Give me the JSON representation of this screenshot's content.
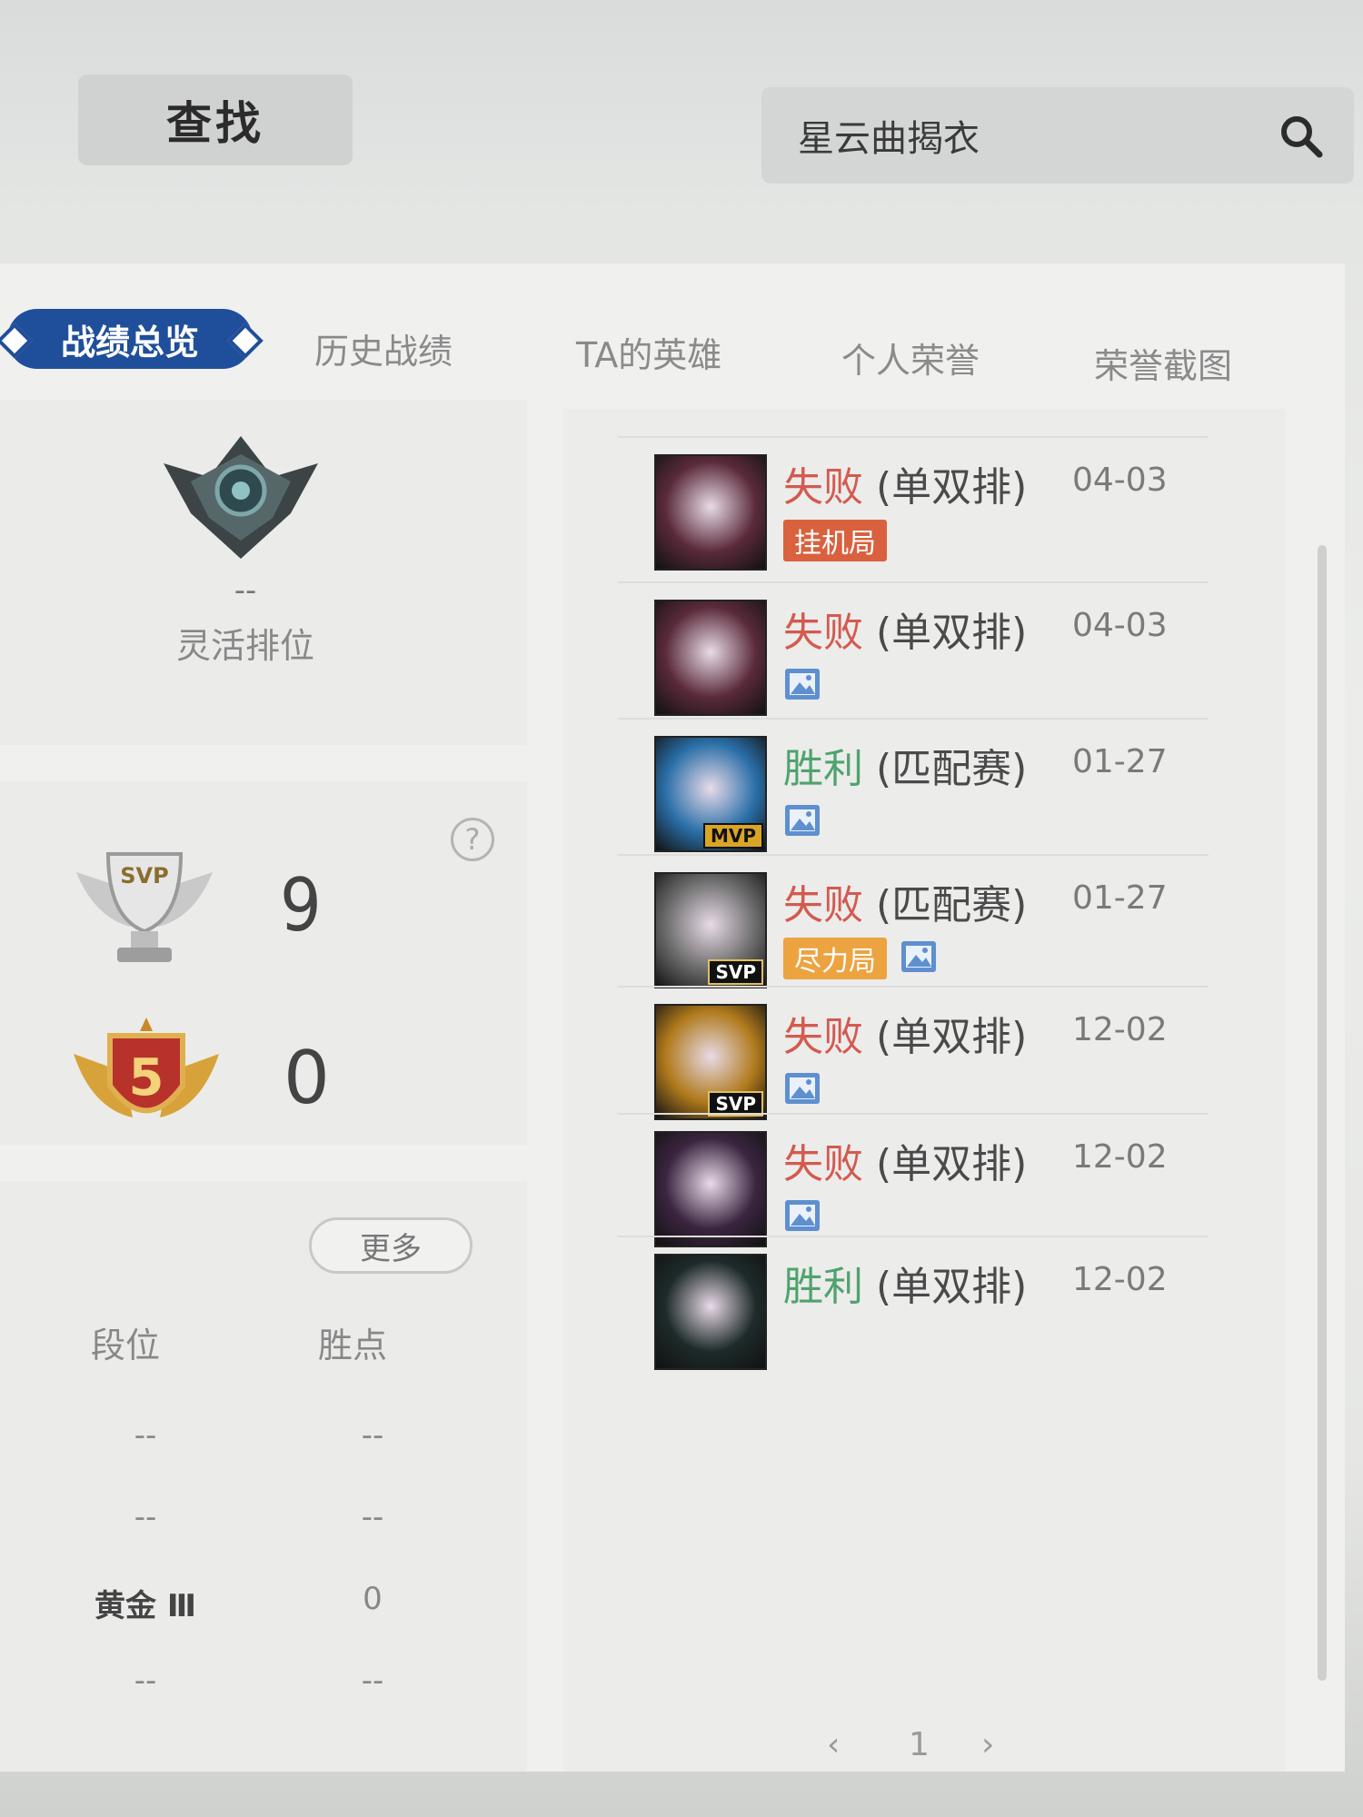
{
  "search": {
    "find_label": "查找",
    "query": "星云曲揭衣"
  },
  "tabs": [
    {
      "label": "战绩总览",
      "active": true
    },
    {
      "label": "历史战绩",
      "active": false
    },
    {
      "label": "TA的英雄",
      "active": false
    },
    {
      "label": "个人荣誉",
      "active": false
    },
    {
      "label": "荣誉截图",
      "active": false
    }
  ],
  "rank": {
    "value": "--",
    "queue": "灵活排位"
  },
  "honors": {
    "help_symbol": "?",
    "svp_label": "SVP",
    "svp_count": "9",
    "penta_label": "5",
    "penta_count": "0"
  },
  "season": {
    "more_label": "更多",
    "headers": [
      "段位",
      "胜点"
    ],
    "rows": [
      [
        "--",
        "--"
      ],
      [
        "--",
        "--"
      ],
      [
        "黄金 Ⅲ",
        "0"
      ],
      [
        "--",
        "--"
      ]
    ]
  },
  "matches": [
    {
      "result": "失败",
      "mode": "(单双排)",
      "date": "04-03",
      "outcome": "lose",
      "tag": "挂机局",
      "tag_type": "afk",
      "pic": false,
      "badge": "",
      "hero_color": "#5a2a3a"
    },
    {
      "result": "失败",
      "mode": "(单双排)",
      "date": "04-03",
      "outcome": "lose",
      "tag": "",
      "tag_type": "",
      "pic": true,
      "badge": "",
      "hero_color": "#5a2a3a"
    },
    {
      "result": "胜利",
      "mode": "(匹配赛)",
      "date": "01-27",
      "outcome": "win",
      "tag": "",
      "tag_type": "",
      "pic": true,
      "badge": "MVP",
      "hero_color": "#2a6fa8"
    },
    {
      "result": "失败",
      "mode": "(匹配赛)",
      "date": "01-27",
      "outcome": "lose",
      "tag": "尽力局",
      "tag_type": "effort",
      "pic": true,
      "badge": "SVP",
      "hero_color": "#6b6b6b"
    },
    {
      "result": "失败",
      "mode": "(单双排)",
      "date": "12-02",
      "outcome": "lose",
      "tag": "",
      "tag_type": "",
      "pic": true,
      "badge": "SVP",
      "hero_color": "#b07a1c"
    },
    {
      "result": "失败",
      "mode": "(单双排)",
      "date": "12-02",
      "outcome": "lose",
      "tag": "",
      "tag_type": "",
      "pic": true,
      "badge": "",
      "hero_color": "#3b2540"
    },
    {
      "result": "胜利",
      "mode": "(单双排)",
      "date": "12-02",
      "outcome": "win",
      "tag": "",
      "tag_type": "",
      "pic": false,
      "badge": "",
      "hero_color": "#1e2a2a"
    }
  ],
  "pager": {
    "prev": "‹",
    "page": "1",
    "next": "›"
  },
  "colors": {
    "tab_active": "#1f4f9a",
    "lose": "#d35a4f",
    "win": "#4fa36d",
    "afk_tag": "#d9613e",
    "effort_tag": "#eda340"
  }
}
